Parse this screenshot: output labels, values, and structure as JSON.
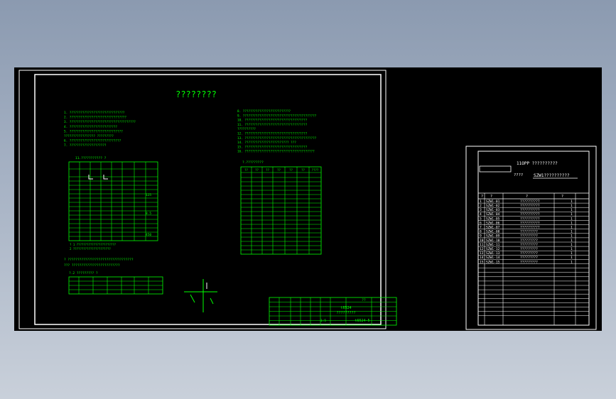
{
  "drawing_sheet": {
    "title": "????????",
    "notes_left": [
      "1.   ??????????????????????????????",
      "2.   ???????????????????????????????",
      "3.   ????????????????????????????????????",
      "4.   ??????????????????????????",
      "5.   ?????????????????????????????",
      "       ?????????????????       ?????????",
      "6.   ????????????????????????????",
      "7.   ????????????????????"
    ],
    "notes_right": [
      "8. ??????????????????????????",
      "9. ????????????????????????????????????????",
      "10. ??????????????????????????????????",
      "11. ??????????????????????????????????",
      "       ??????????",
      "12. ??????????????????????????????????",
      "13. ???????????????????????????????????????",
      "14. ????????????????????????       ???",
      "15. ??????????????????????????????????",
      "16. ??????????????????????????????????????"
    ],
    "table1_caption": "11.???????????  ?",
    "table1_values": [
      "125",
      "8.5",
      "450"
    ],
    "table1_notes": [
      "?   1 ???????????????????????",
      "     2 ??????????????????????"
    ],
    "table2_caption": "?.?????????",
    "table2_values": [
      "??",
      "??",
      "??",
      "??",
      "??",
      "??",
      "????"
    ],
    "note_big": "?   ??????????????????????????????????",
    "note_big2": "??? ?????????????????????????",
    "table3_caption": "?.2 ?????????  ?",
    "title_block": {
      "code": "t6524",
      "name": "?????????",
      "drawing_no": "t6524-5",
      "scale": "1:5",
      "sheet": "??"
    }
  },
  "parts_list": {
    "header_code": "11OPP",
    "header_name": "??????????",
    "assembly_label": "????",
    "assembly_code": "SZW1??????????",
    "col_headers": [
      "?",
      "?",
      "?",
      "?"
    ],
    "rows": [
      {
        "no": "1",
        "code": "SZW1-01",
        "name": "??????????",
        "qty": "1"
      },
      {
        "no": "2",
        "code": "SZW1-02",
        "name": "??????????",
        "qty": "1"
      },
      {
        "no": "3",
        "code": "SZW1-03",
        "name": "??????????",
        "qty": "1"
      },
      {
        "no": "4",
        "code": "SZW1-04",
        "name": "??????????",
        "qty": "1"
      },
      {
        "no": "5",
        "code": "SZW1-05",
        "name": "??????????",
        "qty": "1"
      },
      {
        "no": "6",
        "code": "SZW1-06",
        "name": "??????????",
        "qty": "1"
      },
      {
        "no": "7",
        "code": "SZW1-07",
        "name": "??????????",
        "qty": "1"
      },
      {
        "no": "8",
        "code": "SZW1-08",
        "name": "?????????",
        "qty": "1"
      },
      {
        "no": "9",
        "code": "SZW1-09",
        "name": "?????????",
        "qty": "1"
      },
      {
        "no": "10",
        "code": "SZW1-10",
        "name": "?????????",
        "qty": "1"
      },
      {
        "no": "11",
        "code": "SZW1-11",
        "name": "?????????",
        "qty": "1"
      },
      {
        "no": "12",
        "code": "SZW1-12",
        "name": "?????????",
        "qty": "1"
      },
      {
        "no": "13",
        "code": "SZW1-13",
        "name": "?????????",
        "qty": "1"
      },
      {
        "no": "14",
        "code": "SZW1-14",
        "name": "?????????",
        "qty": "1"
      },
      {
        "no": "15",
        "code": "SZW1-15",
        "name": "?????????",
        "qty": "1"
      }
    ]
  },
  "colors": {
    "line": "#00ff00",
    "frame": "#ffffff",
    "background": "#000000"
  }
}
